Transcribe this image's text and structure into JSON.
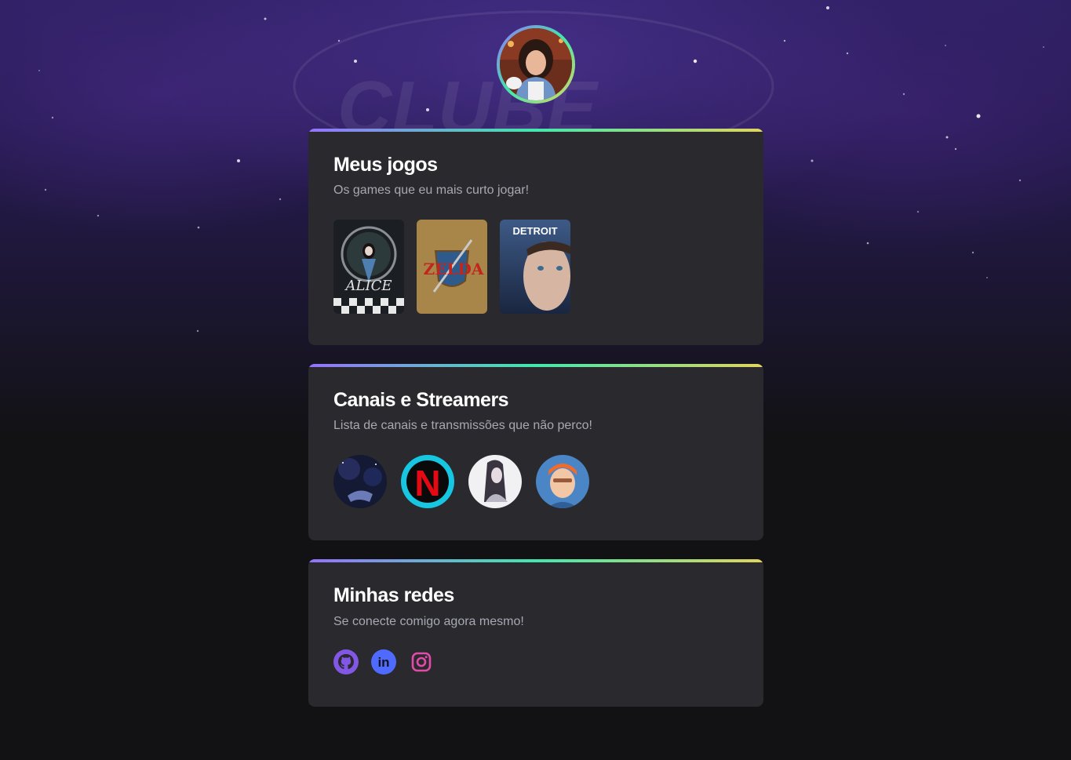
{
  "profile": {
    "avatar_alt": "Foto de perfil"
  },
  "games_section": {
    "title": "Meus jogos",
    "subtitle": "Os games que eu mais curto jogar!",
    "games": [
      {
        "name": "Alice: Madness Returns",
        "cover_text": "ALICE"
      },
      {
        "name": "The Legend of Zelda: Ocarina of Time",
        "cover_text": "ZELDA"
      },
      {
        "name": "Detroit: Become Human",
        "cover_text": "DETROIT"
      }
    ]
  },
  "channels_section": {
    "title": "Canais e Streamers",
    "subtitle": "Lista de canais e transmissões que não perco!",
    "channel_logo_letter": "N"
  },
  "socials_section": {
    "title": "Minhas redes",
    "subtitle": "Se conecte comigo agora mesmo!",
    "linkedin_text": "in"
  },
  "icons": {
    "github": "github-icon",
    "linkedin": "linkedin-icon",
    "instagram": "instagram-icon"
  },
  "colors": {
    "gradient_start": "#9572fc",
    "gradient_mid": "#43e7ad",
    "gradient_end": "#e1d55d",
    "card_bg": "#29292e",
    "page_bg": "#121214",
    "github": "#8257e5",
    "linkedin": "#4f6bff",
    "instagram": "#e34ba9"
  }
}
